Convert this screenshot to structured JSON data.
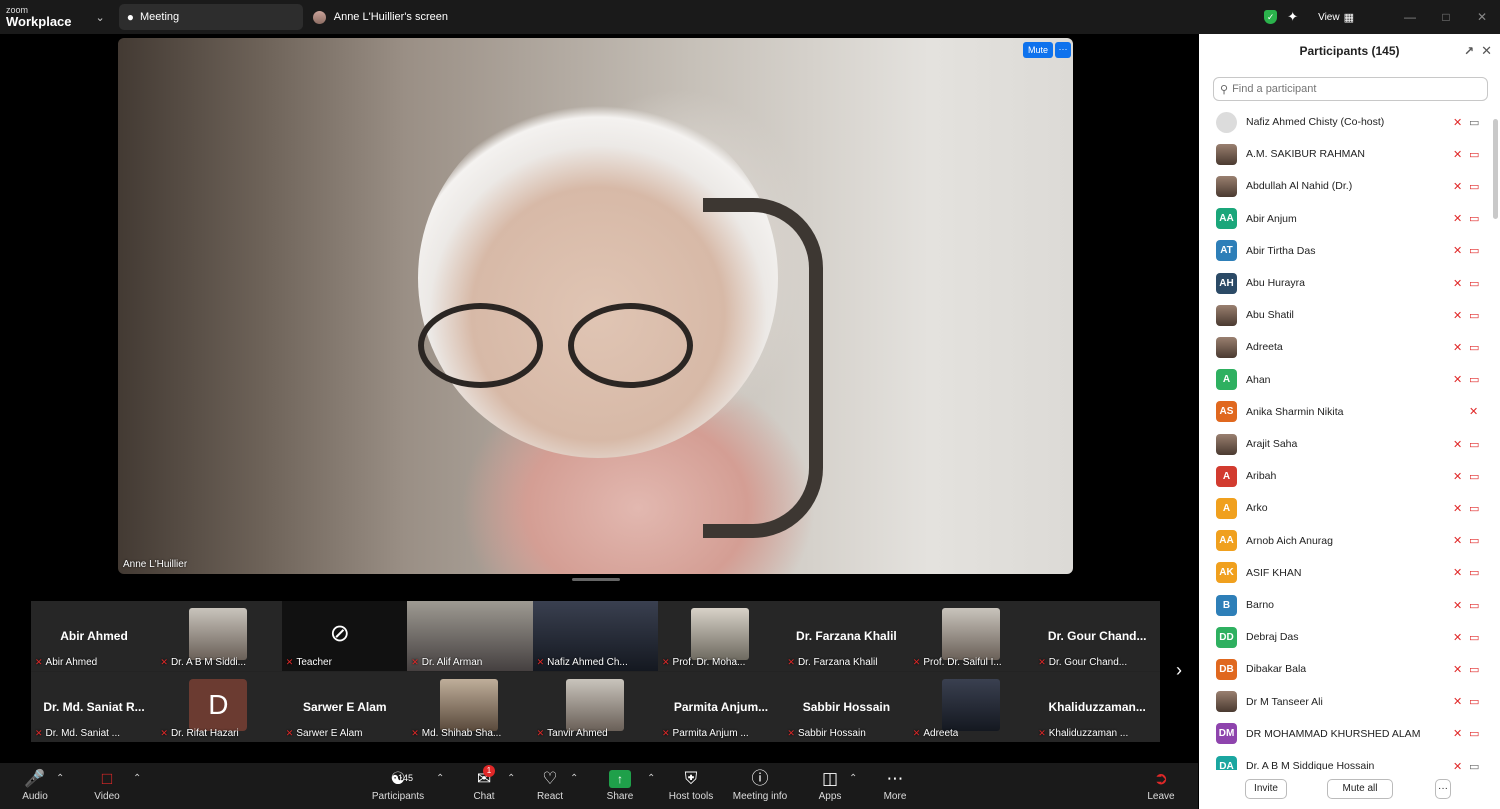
{
  "titlebar": {
    "brand_top": "zoom",
    "brand_bottom": "Workplace",
    "meeting_tab": "Meeting",
    "screen_tab": "Anne L'Huillier's screen",
    "view_label": "View"
  },
  "stage": {
    "speaker_name": "Anne L'Huillier",
    "mute_label": "Mute",
    "more_label": "···"
  },
  "tiles": [
    {
      "name": "Abir Ahmed",
      "label": "Abir Ahmed",
      "kind": "name"
    },
    {
      "name": "",
      "label": "Dr. A B M Siddi...",
      "kind": "photo"
    },
    {
      "name": "",
      "label": "Teacher",
      "kind": "camoff"
    },
    {
      "name": "",
      "label": "Dr. Alif Arman",
      "kind": "full"
    },
    {
      "name": "",
      "label": "Nafiz Ahmed Ch...",
      "kind": "full"
    },
    {
      "name": "",
      "label": "Prof. Dr. Moha...",
      "kind": "photo"
    },
    {
      "name": "Dr. Farzana Khalil",
      "label": "Dr. Farzana Khalil",
      "kind": "name"
    },
    {
      "name": "",
      "label": "Prof. Dr. Saiful I...",
      "kind": "photo"
    },
    {
      "name": "Dr. Gour Chand...",
      "label": "Dr. Gour Chand...",
      "kind": "name"
    },
    {
      "name": "Dr. Md. Saniat R...",
      "label": "Dr. Md. Saniat ...",
      "kind": "name"
    },
    {
      "name": "D",
      "label": "Dr. Rifat Hazari",
      "kind": "letter"
    },
    {
      "name": "Sarwer E Alam",
      "label": "Sarwer E Alam",
      "kind": "name"
    },
    {
      "name": "",
      "label": "Md. Shihab Sha...",
      "kind": "photo"
    },
    {
      "name": "",
      "label": "Tanvir Ahmed",
      "kind": "photo"
    },
    {
      "name": "Parmita Anjum...",
      "label": "Parmita Anjum ...",
      "kind": "name"
    },
    {
      "name": "Sabbir Hossain",
      "label": "Sabbir Hossain",
      "kind": "name"
    },
    {
      "name": "",
      "label": "Adreeta",
      "kind": "photo"
    },
    {
      "name": "Khaliduzzaman...",
      "label": "Khaliduzzaman ...",
      "kind": "name"
    }
  ],
  "toolbar": {
    "audio": "Audio",
    "video": "Video",
    "participants": "Participants",
    "participants_count": "145",
    "chat": "Chat",
    "chat_badge": "1",
    "react": "React",
    "share": "Share",
    "host_tools": "Host tools",
    "meeting_info": "Meeting info",
    "apps": "Apps",
    "more": "More",
    "leave": "Leave"
  },
  "panel": {
    "title": "Participants (145)",
    "search_placeholder": "Find a participant",
    "invite": "Invite",
    "mute_all": "Mute all",
    "more": "···",
    "participants": [
      {
        "name": "Nafiz Ahmed Chisty (Co-host)",
        "initials": "",
        "color": "",
        "avatar": "blank",
        "cam": "on"
      },
      {
        "name": "A.M. SAKIBUR RAHMAN",
        "initials": "",
        "color": "",
        "avatar": "photo",
        "cam": "off"
      },
      {
        "name": "Abdullah Al Nahid (Dr.)",
        "initials": "",
        "color": "",
        "avatar": "photo",
        "cam": "off"
      },
      {
        "name": "Abir Anjum",
        "initials": "AA",
        "color": "#1aa67a",
        "avatar": "initials",
        "cam": "off"
      },
      {
        "name": "Abir Tirtha Das",
        "initials": "AT",
        "color": "#2e7fb8",
        "avatar": "initials",
        "cam": "off"
      },
      {
        "name": "Abu Hurayra",
        "initials": "AH",
        "color": "#2b4a66",
        "avatar": "initials",
        "cam": "off"
      },
      {
        "name": "Abu Shatil",
        "initials": "",
        "color": "",
        "avatar": "photo",
        "cam": "off"
      },
      {
        "name": "Adreeta",
        "initials": "",
        "color": "",
        "avatar": "photo",
        "cam": "off"
      },
      {
        "name": "Ahan",
        "initials": "A",
        "color": "#2eb060",
        "avatar": "initials",
        "cam": "off"
      },
      {
        "name": "Anika Sharmin Nikita",
        "initials": "AS",
        "color": "#e0681f",
        "avatar": "initials",
        "cam": "none"
      },
      {
        "name": "Arajit Saha",
        "initials": "",
        "color": "",
        "avatar": "photo",
        "cam": "off"
      },
      {
        "name": "Aribah",
        "initials": "A",
        "color": "#d23b2f",
        "avatar": "initials",
        "cam": "off"
      },
      {
        "name": "Arko",
        "initials": "A",
        "color": "#f0a01e",
        "avatar": "initials",
        "cam": "off"
      },
      {
        "name": "Arnob Aich Anurag",
        "initials": "AA",
        "color": "#f0a01e",
        "avatar": "initials",
        "cam": "off"
      },
      {
        "name": "ASIF KHAN",
        "initials": "AK",
        "color": "#f0a01e",
        "avatar": "initials",
        "cam": "off"
      },
      {
        "name": "Barno",
        "initials": "B",
        "color": "#2e7fb8",
        "avatar": "initials",
        "cam": "off"
      },
      {
        "name": "Debraj Das",
        "initials": "DD",
        "color": "#2eb060",
        "avatar": "initials",
        "cam": "off"
      },
      {
        "name": "Dibakar Bala",
        "initials": "DB",
        "color": "#e0681f",
        "avatar": "initials",
        "cam": "off"
      },
      {
        "name": "Dr M Tanseer Ali",
        "initials": "",
        "color": "",
        "avatar": "photo",
        "cam": "off"
      },
      {
        "name": "DR MOHAMMAD KHURSHED ALAM",
        "initials": "DM",
        "color": "#8e44ad",
        "avatar": "initials",
        "cam": "off"
      },
      {
        "name": "Dr. A B M Siddique Hossain",
        "initials": "DA",
        "color": "#1aa6a0",
        "avatar": "initials",
        "cam": "on"
      }
    ]
  },
  "colors": {
    "accent": "#0e72ed",
    "muted_red": "#e02828",
    "share_green": "#1fa04a"
  }
}
